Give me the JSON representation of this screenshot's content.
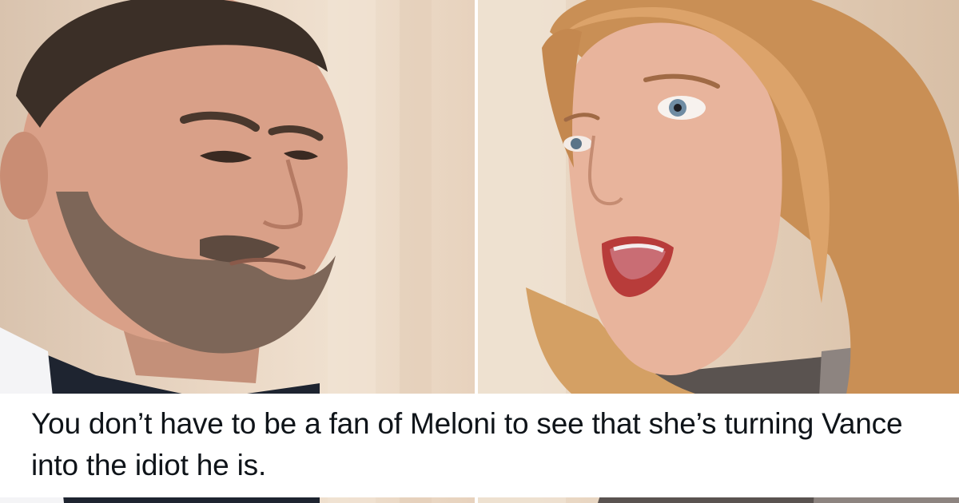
{
  "photo": {
    "left_panel": {
      "description_icon": "man-face-photo"
    },
    "right_panel": {
      "description_icon": "woman-face-photo"
    }
  },
  "caption": {
    "text": "You don’t have to be a fan of Meloni to see that she’s turning Vance into the idiot he is."
  }
}
